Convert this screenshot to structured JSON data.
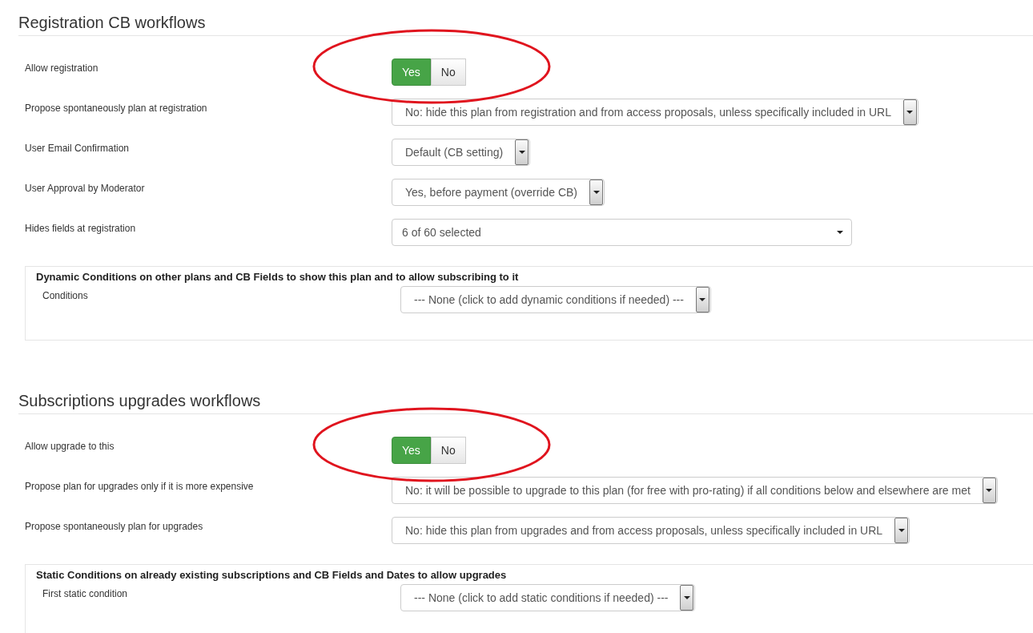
{
  "sections": [
    {
      "title": "Registration CB workflows",
      "rows": [
        {
          "label": "Allow registration",
          "kind": "toggle",
          "circled": true,
          "options": [
            {
              "label": "Yes",
              "selected": true
            },
            {
              "label": "No",
              "selected": false
            }
          ]
        },
        {
          "label": "Propose spontaneously plan at registration",
          "kind": "select",
          "value": "No: hide this plan from registration and from access proposals, unless specifically included in URL"
        },
        {
          "label": "User Email Confirmation",
          "kind": "select",
          "value": "Default (CB setting)"
        },
        {
          "label": "User Approval by Moderator",
          "kind": "select",
          "value": "Yes, before payment (override CB)"
        },
        {
          "label": "Hides fields at registration",
          "kind": "multiselect",
          "value": "6 of 60 selected"
        }
      ],
      "fieldset": {
        "legend": "Dynamic Conditions on other plans and CB Fields to show this plan and to allow subscribing to it",
        "rows": [
          {
            "label": "Conditions",
            "kind": "select",
            "value": "--- None (click to add dynamic conditions if needed) ---"
          }
        ]
      }
    },
    {
      "title": "Subscriptions upgrades workflows",
      "rows": [
        {
          "label": "Allow upgrade to this",
          "kind": "toggle",
          "circled": true,
          "options": [
            {
              "label": "Yes",
              "selected": true
            },
            {
              "label": "No",
              "selected": false
            }
          ]
        },
        {
          "label": "Propose plan for upgrades only if it is more expensive",
          "kind": "select",
          "value": "No: it will be possible to upgrade to this plan (for free with pro-rating) if all conditions below and elsewhere are met"
        },
        {
          "label": "Propose spontaneously plan for upgrades",
          "kind": "select",
          "value": "No: hide this plan from upgrades and from access proposals, unless specifically included in URL"
        }
      ],
      "fieldset": {
        "legend": "Static Conditions on already existing subscriptions and CB Fields and Dates to allow upgrades",
        "rows": [
          {
            "label": "First static condition",
            "kind": "select",
            "value": "--- None (click to add static conditions if needed) ---"
          }
        ]
      }
    }
  ]
}
